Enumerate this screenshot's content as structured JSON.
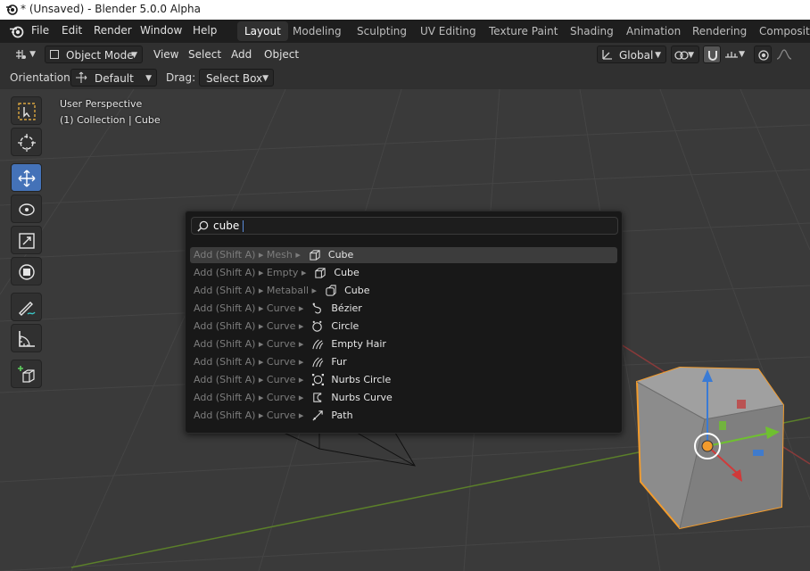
{
  "window": {
    "title": "* (Unsaved) - Blender 5.0.0 Alpha"
  },
  "menu": [
    "File",
    "Edit",
    "Render",
    "Window",
    "Help"
  ],
  "workspace_tabs": [
    {
      "label": "Layout",
      "active": true
    },
    {
      "label": "Modeling"
    },
    {
      "label": "Sculpting"
    },
    {
      "label": "UV Editing"
    },
    {
      "label": "Texture Paint"
    },
    {
      "label": "Shading"
    },
    {
      "label": "Animation"
    },
    {
      "label": "Rendering"
    },
    {
      "label": "Compositing"
    }
  ],
  "header": {
    "mode": "Object Mode",
    "menus": [
      "View",
      "Select",
      "Add",
      "Object"
    ],
    "transform_orientation": "Global"
  },
  "tool_settings": {
    "orientation_label": "Orientation:",
    "orientation_value": "Default",
    "drag_label": "Drag:",
    "drag_value": "Select Box"
  },
  "tools": [
    {
      "icon": "select-box-icon",
      "active": false
    },
    {
      "icon": "cursor-icon",
      "active": false
    },
    {
      "icon": "move-icon",
      "active": true
    },
    {
      "icon": "rotate-icon",
      "active": false
    },
    {
      "icon": "scale-icon",
      "active": false
    },
    {
      "icon": "transform-icon",
      "active": false
    },
    {
      "icon": "annotate-icon",
      "active": false
    },
    {
      "icon": "measure-icon",
      "active": false
    },
    {
      "icon": "add-cube-icon",
      "active": false
    }
  ],
  "viewport": {
    "perspective_label": "User Perspective",
    "collection_label": "(1) Collection | Cube"
  },
  "search": {
    "query": "cube",
    "results": [
      {
        "path": "Add (Shift A) ▸ Mesh ▸",
        "name": "Cube",
        "icon": "mesh-cube-icon",
        "highlighted": true
      },
      {
        "path": "Add (Shift A) ▸ Empty ▸",
        "name": "Cube",
        "icon": "empty-cube-icon"
      },
      {
        "path": "Add (Shift A) ▸ Metaball ▸",
        "name": "Cube",
        "icon": "metaball-cube-icon"
      },
      {
        "path": "Add (Shift A) ▸ Curve ▸",
        "name": "Bézier",
        "icon": "bezier-curve-icon"
      },
      {
        "path": "Add (Shift A) ▸ Curve ▸",
        "name": "Circle",
        "icon": "curve-circle-icon"
      },
      {
        "path": "Add (Shift A) ▸ Curve ▸",
        "name": "Empty Hair",
        "icon": "hair-icon"
      },
      {
        "path": "Add (Shift A) ▸ Curve ▸",
        "name": "Fur",
        "icon": "fur-icon"
      },
      {
        "path": "Add (Shift A) ▸ Curve ▸",
        "name": "Nurbs Circle",
        "icon": "nurbs-circle-icon"
      },
      {
        "path": "Add (Shift A) ▸ Curve ▸",
        "name": "Nurbs Curve",
        "icon": "nurbs-curve-icon"
      },
      {
        "path": "Add (Shift A) ▸ Curve ▸",
        "name": "Path",
        "icon": "curve-path-icon"
      }
    ]
  },
  "colors": {
    "accent": "#4472b8",
    "selection_outline": "#f29b2c",
    "axis_x": "#b43c3c",
    "axis_y": "#6a9a2c"
  }
}
